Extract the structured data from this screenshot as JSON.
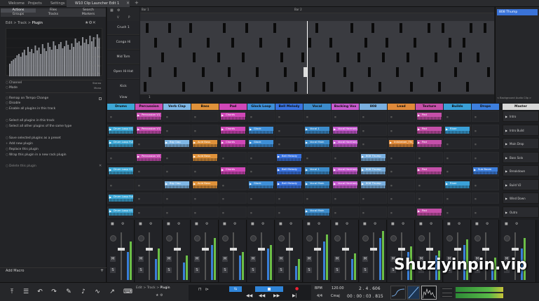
{
  "topbar": {
    "tabs": [
      "Welcome",
      "Projects",
      "Settings",
      "W10 Clip Launcher Edit 1"
    ],
    "close": "×",
    "add": "+"
  },
  "left": {
    "buttons": [
      "Actions",
      "Files",
      "Search",
      "Groups",
      "Tracks",
      "Markers"
    ],
    "breadcrumb": [
      "Edit",
      ">",
      "Track",
      ">",
      "Plugin"
    ],
    "db_labels": [
      "-12 dB",
      "-24 dB",
      "-36 dB",
      "-48 dB",
      "-60 dB"
    ],
    "rows": [
      {
        "label": "Channel",
        "value": "Stereo"
      },
      {
        "label": "Mode",
        "value": "Mono"
      }
    ],
    "menu": [
      "Remap on Tempo Change",
      "Disable",
      "Enable all plugins in this track",
      "Select all plugins in this track",
      "Select all other plugins of the same type",
      "Save selected plugins as a preset",
      "Add new plugin",
      "Replace this plugin",
      "Wrap this plugin in a new rack plugin",
      "Delete this plugin"
    ],
    "add_macro": "Add Macro"
  },
  "arranger": {
    "bars": [
      "1",
      "Bar 1",
      "Bar 2"
    ],
    "lanes": [
      "Crush 1",
      "Conga Hi",
      "Mid Tom",
      "Open Hi-Hat",
      "Kick",
      "View"
    ],
    "inspector_title": "808 Thump",
    "inspector_footer": "< Background Audio Clip >"
  },
  "launcher": {
    "columns": [
      {
        "name": "Drums",
        "color": "#3da7d6"
      },
      {
        "name": "Percussion",
        "color": "#c94fb3"
      },
      {
        "name": "Verb Clap",
        "color": "#7fb7e6"
      },
      {
        "name": "Bass",
        "color": "#e0923a"
      },
      {
        "name": "Pad",
        "color": "#d047b8"
      },
      {
        "name": "Glock Loop",
        "color": "#3e8fd8"
      },
      {
        "name": "Bell Melody",
        "color": "#3a73e0"
      },
      {
        "name": "Vocal",
        "color": "#3c8ccc"
      },
      {
        "name": "Backing Vox",
        "color": "#c65ad0"
      },
      {
        "name": "808",
        "color": "#7ab0e0"
      },
      {
        "name": "Lead",
        "color": "#e08a3a"
      },
      {
        "name": "Texture",
        "color": "#c54fa9"
      },
      {
        "name": "Builds",
        "color": "#3aa0d8"
      },
      {
        "name": "Drops",
        "color": "#3d7fde"
      }
    ],
    "master": "Master",
    "scenes": [
      "Intro",
      "Intro Build",
      "Main Drop",
      "Bass Solo",
      "Breakdown",
      "Build V2",
      "Wind Down",
      "Outro"
    ],
    "clips": [
      {
        "col": 1,
        "row": 0,
        "label": "Percussion V1"
      },
      {
        "col": 4,
        "row": 0,
        "label": "Chords"
      },
      {
        "col": 11,
        "row": 0,
        "label": "Pad"
      },
      {
        "col": 0,
        "row": 1,
        "label": "Drum Loop V1"
      },
      {
        "col": 1,
        "row": 1,
        "label": "Percussion V1"
      },
      {
        "col": 4,
        "row": 1,
        "label": "Chords"
      },
      {
        "col": 5,
        "row": 1,
        "label": "Glock"
      },
      {
        "col": 7,
        "row": 1,
        "label": "Vocal 1"
      },
      {
        "col": 8,
        "row": 1,
        "label": "Vocal Harmony"
      },
      {
        "col": 11,
        "row": 1,
        "label": "Pad"
      },
      {
        "col": 12,
        "row": 1,
        "label": "Riser"
      },
      {
        "col": 0,
        "row": 2,
        "label": "Drum Loop Full"
      },
      {
        "col": 2,
        "row": 2,
        "label": "Big Clap"
      },
      {
        "col": 3,
        "row": 2,
        "label": "Acid Bass"
      },
      {
        "col": 4,
        "row": 2,
        "label": "Chords"
      },
      {
        "col": 5,
        "row": 2,
        "label": "Glock"
      },
      {
        "col": 7,
        "row": 2,
        "label": "Vocal Main"
      },
      {
        "col": 8,
        "row": 2,
        "label": "Vocal Harmony"
      },
      {
        "col": 10,
        "row": 2,
        "label": "InitAmber_TN_N"
      },
      {
        "col": 11,
        "row": 2,
        "label": "Pad"
      },
      {
        "col": 1,
        "row": 3,
        "label": "Percussion V2"
      },
      {
        "col": 3,
        "row": 3,
        "label": "Acid Bass"
      },
      {
        "col": 6,
        "row": 3,
        "label": "Bell Melody"
      },
      {
        "col": 9,
        "row": 3,
        "label": "808 Thump"
      },
      {
        "col": 0,
        "row": 4,
        "label": "Drum Loop V2"
      },
      {
        "col": 4,
        "row": 4,
        "label": "Chords"
      },
      {
        "col": 6,
        "row": 4,
        "label": "Bell Melody"
      },
      {
        "col": 7,
        "row": 4,
        "label": "Vocal 1"
      },
      {
        "col": 8,
        "row": 4,
        "label": "Vocal Harmony"
      },
      {
        "col": 9,
        "row": 4,
        "label": "808 Thump"
      },
      {
        "col": 11,
        "row": 4,
        "label": "Pad"
      },
      {
        "col": 13,
        "row": 4,
        "label": "Sub Boom"
      },
      {
        "col": 2,
        "row": 5,
        "label": "Big Clap"
      },
      {
        "col": 3,
        "row": 5,
        "label": "Acid Bass"
      },
      {
        "col": 5,
        "row": 5,
        "label": "Glock"
      },
      {
        "col": 6,
        "row": 5,
        "label": "Bell Melody"
      },
      {
        "col": 7,
        "row": 5,
        "label": "Vocal Main"
      },
      {
        "col": 8,
        "row": 5,
        "label": "Vocal Harmony"
      },
      {
        "col": 9,
        "row": 5,
        "label": "808 Thump"
      },
      {
        "col": 12,
        "row": 5,
        "label": "Riser"
      },
      {
        "col": 0,
        "row": 6,
        "label": "Drum Loop Full"
      },
      {
        "col": 0,
        "row": 7,
        "label": "Drum Loop V1"
      },
      {
        "col": 7,
        "row": 7,
        "label": "Vocal Main"
      },
      {
        "col": 11,
        "row": 7,
        "label": "Pad"
      }
    ]
  },
  "mixer": {
    "mute": "M",
    "solo": "S"
  },
  "transport": {
    "breadcrumb": [
      "Edit",
      ">",
      "Track",
      ">",
      "Plugin"
    ],
    "bpm_label": "BPM",
    "bpm": "120.00",
    "position": "2 . 4 . 606",
    "sig": "4/4",
    "key": "Cmaj",
    "time": "00 : 00 : 03 . 815"
  },
  "watermark": "Shuziyinpin.vip"
}
